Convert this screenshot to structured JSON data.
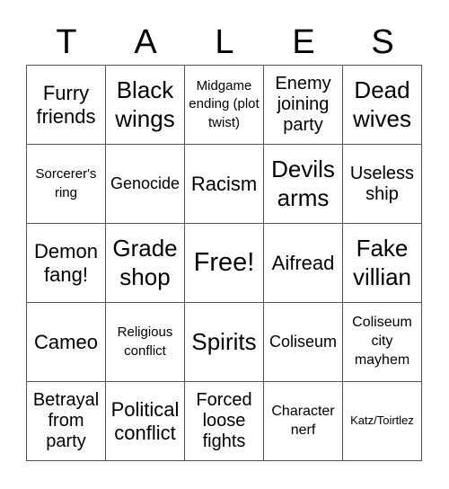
{
  "title_letters": [
    "T",
    "A",
    "L",
    "E",
    "S"
  ],
  "grid": [
    [
      "Furry friends",
      "Black wings",
      "Midgame ending (plot twist)",
      "Enemy joining party",
      "Dead wives"
    ],
    [
      "Sorcerer's ring",
      "Genocide",
      "Racism",
      "Devils arms",
      "Useless ship"
    ],
    [
      "Demon fang!",
      "Grade shop",
      "Free!",
      "Aifread",
      "Fake villian"
    ],
    [
      "Cameo",
      "Religious conflict",
      "Spirits",
      "Coliseum",
      "Coliseum city mayhem"
    ],
    [
      "Betrayal from party",
      "Political conflict",
      "Forced loose fights",
      "Character nerf",
      "Katz/Toirtlez"
    ]
  ]
}
